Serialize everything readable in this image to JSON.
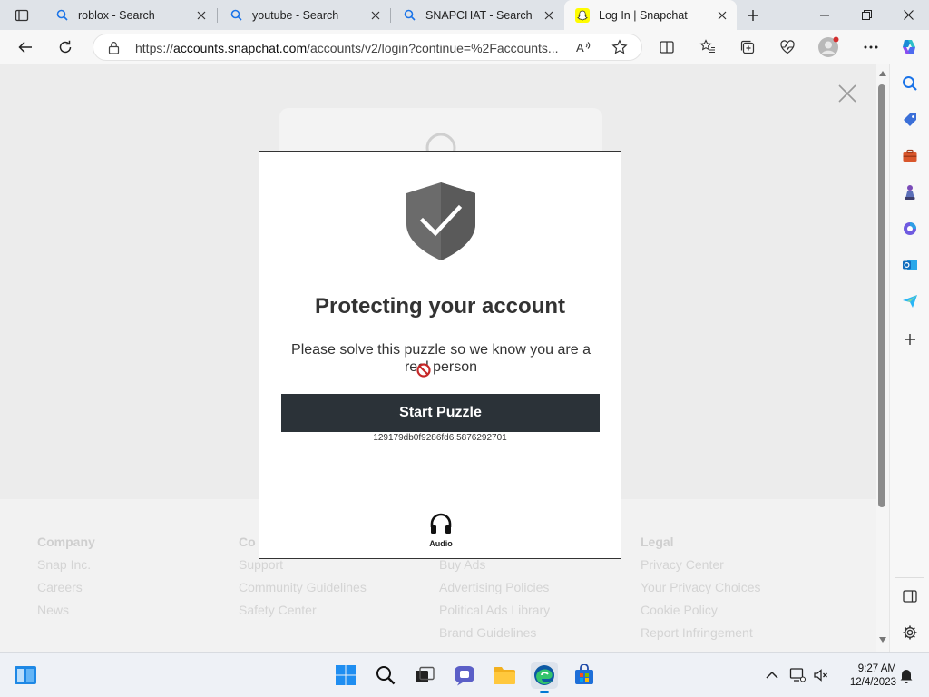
{
  "browser": {
    "tabs": [
      {
        "title": "roblox - Search",
        "icon": "search-icon"
      },
      {
        "title": "youtube - Search",
        "icon": "search-icon"
      },
      {
        "title": "SNAPCHAT - Search",
        "icon": "search-icon"
      },
      {
        "title": "Log In | Snapchat",
        "icon": "snapchat-ghost-icon",
        "active": true
      }
    ],
    "url_prefix": "https://",
    "url_host": "accounts.snapchat.com",
    "url_rest": "/accounts/v2/login?continue=%2Faccounts..."
  },
  "modal": {
    "title": "Protecting your account",
    "description": "Please solve this puzzle so we know you are a real person",
    "start_button": "Start Puzzle",
    "session_id": "129179db0f9286fd6.5876292701",
    "audio_label": "Audio"
  },
  "footer": {
    "columns": [
      {
        "heading": "Company",
        "links": [
          "Snap Inc.",
          "Careers",
          "News"
        ]
      },
      {
        "heading": "Co",
        "links": [
          "Support",
          "Community Guidelines",
          "Safety Center"
        ]
      },
      {
        "heading": "",
        "links": [
          "Buy Ads",
          "Advertising Policies",
          "Political Ads Library",
          "Brand Guidelines"
        ]
      },
      {
        "heading": "Legal",
        "links": [
          "Privacy Center",
          "Your Privacy Choices",
          "Cookie Policy",
          "Report Infringement"
        ]
      }
    ]
  },
  "taskbar": {
    "time": "9:27 AM",
    "date": "12/4/2023"
  },
  "colors": {
    "button_dark": "#2b3238",
    "shield_gray": "#666666",
    "edge_blue": "#0078d4"
  }
}
